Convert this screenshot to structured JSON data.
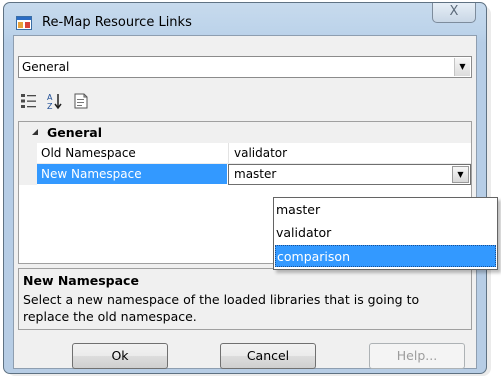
{
  "window": {
    "title": "Re-Map Resource Links",
    "close_glyph": "⊠",
    "close_label": "X"
  },
  "object_selector": {
    "value": "General"
  },
  "property_grid": {
    "category": "General",
    "rows": [
      {
        "name": "Old Namespace",
        "value": "validator"
      },
      {
        "name": "New Namespace",
        "value": "master"
      }
    ],
    "dropdown_options": [
      "master",
      "validator",
      "comparison"
    ],
    "highlighted_option": "comparison"
  },
  "description": {
    "title": "New Namespace",
    "text": "Select a new namespace of the loaded libraries that is going to replace the old namespace."
  },
  "buttons": {
    "ok": "Ok",
    "cancel": "Cancel",
    "help": "Help..."
  },
  "colors": {
    "selection": "#3399ff",
    "window_frame": "#b9cfe6"
  }
}
